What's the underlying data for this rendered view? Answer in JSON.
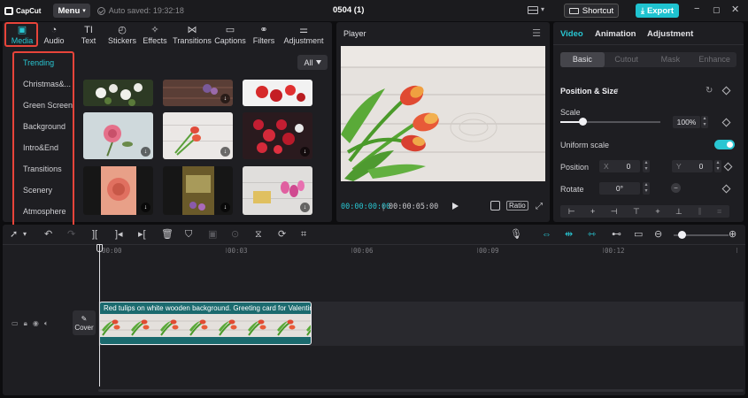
{
  "app": {
    "logo_text": "CapCut",
    "menu_label": "Menu",
    "autosave_text": "Auto saved: 19:32:18",
    "project_title": "0504 (1)",
    "shortcut_label": "Shortcut",
    "export_label": "Export",
    "accent_color": "#29c6d2",
    "highlight_color": "#e8443a"
  },
  "media_tabs": [
    {
      "label": "Media",
      "icon": "media-icon",
      "active": true
    },
    {
      "label": "Audio",
      "icon": "audio-icon"
    },
    {
      "label": "Text",
      "icon": "text-icon"
    },
    {
      "label": "Stickers",
      "icon": "stickers-icon"
    },
    {
      "label": "Effects",
      "icon": "effects-icon"
    },
    {
      "label": "Transitions",
      "icon": "transitions-icon"
    },
    {
      "label": "Captions",
      "icon": "captions-icon"
    },
    {
      "label": "Filters",
      "icon": "filters-icon"
    },
    {
      "label": "Adjustment",
      "icon": "adjustment-icon"
    }
  ],
  "sidebar": {
    "items": [
      {
        "label": "Trending",
        "active": true
      },
      {
        "label": "Christmas&..."
      },
      {
        "label": "Green Screen"
      },
      {
        "label": "Background"
      },
      {
        "label": "Intro&End"
      },
      {
        "label": "Transitions"
      },
      {
        "label": "Scenery"
      },
      {
        "label": "Atmosphere"
      }
    ]
  },
  "filter": {
    "label": "All"
  },
  "player": {
    "title": "Player",
    "current_time": "00:00:00:00",
    "separator": "|",
    "duration": "00:00:05:00",
    "ratio_label": "Ratio"
  },
  "properties": {
    "tabs": [
      {
        "label": "Video",
        "active": true
      },
      {
        "label": "Animation"
      },
      {
        "label": "Adjustment"
      }
    ],
    "subtabs": [
      {
        "label": "Basic",
        "active": true
      },
      {
        "label": "Cutout"
      },
      {
        "label": "Mask"
      },
      {
        "label": "Enhance"
      }
    ],
    "section_title": "Position & Size",
    "scale_label": "Scale",
    "scale_value": "100%",
    "scale_fraction": 0.22,
    "uniform_scale_label": "Uniform scale",
    "uniform_scale_on": true,
    "position_label": "Position",
    "pos_x_label": "X",
    "pos_x_value": "0",
    "pos_y_label": "Y",
    "pos_y_value": "0",
    "rotate_label": "Rotate",
    "rotate_value": "0°"
  },
  "timeline": {
    "ruler": [
      "00:00",
      "00:03",
      "00:06",
      "00:09",
      "00:12"
    ],
    "cover_label": "Cover",
    "clip_label": "Red tulips on white wooden background. Greeting card for Valentin",
    "zoom_fraction": 0.15
  }
}
